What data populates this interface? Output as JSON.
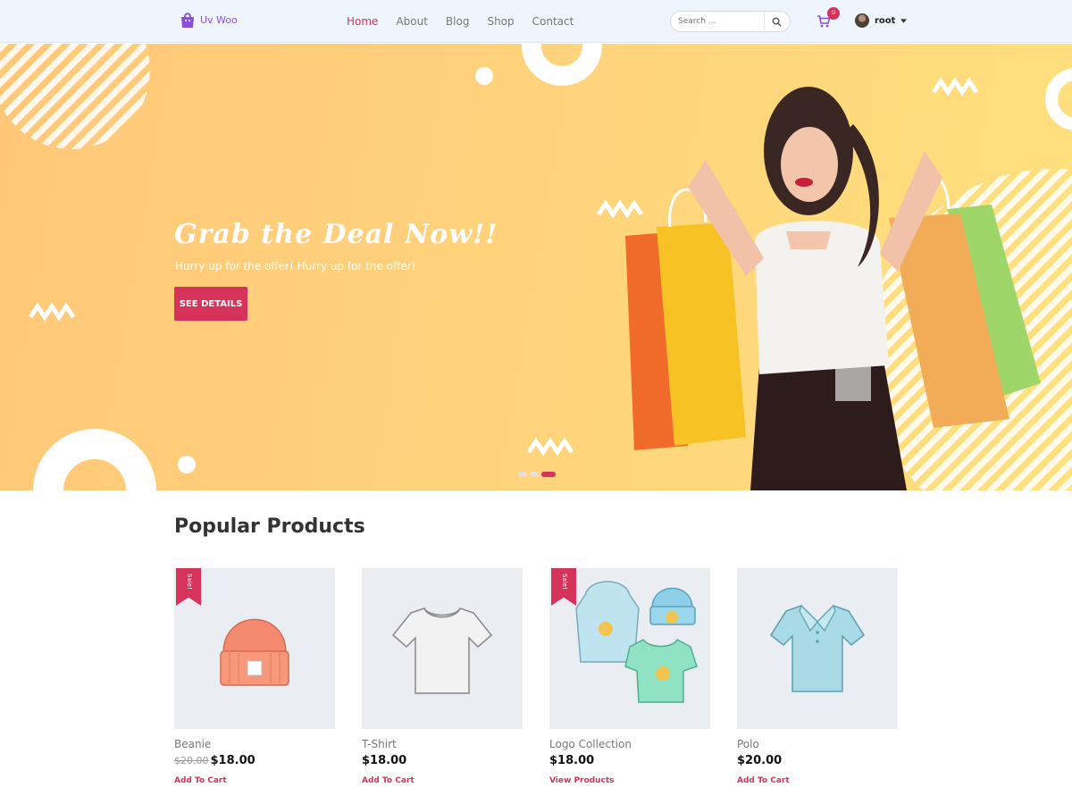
{
  "header": {
    "logo_text": "Uv Woo",
    "nav": [
      {
        "label": "Home",
        "active": true
      },
      {
        "label": "About",
        "active": false
      },
      {
        "label": "Blog",
        "active": false
      },
      {
        "label": "Shop",
        "active": false
      },
      {
        "label": "Contact",
        "active": false
      }
    ],
    "search_placeholder": "Search ...",
    "cart_count": "0",
    "user_name": "root"
  },
  "hero": {
    "title": "Grab the Deal Now!!",
    "subtitle": "Hurry up for the offer! Hurry up for the offer!",
    "button_label": "SEE DETAILS",
    "active_slide": 3,
    "slide_count": 3
  },
  "products_section": {
    "title": "Popular Products",
    "items": [
      {
        "name": "Beanie",
        "sale": true,
        "sale_label": "Sale!",
        "old_price": "$20.00",
        "price": "$18.00",
        "action": "Add To Cart"
      },
      {
        "name": "T-Shirt",
        "sale": false,
        "sale_label": "",
        "old_price": "",
        "price": "$18.00",
        "action": "Add To Cart"
      },
      {
        "name": "Logo Collection",
        "sale": true,
        "sale_label": "Sale!",
        "old_price": "",
        "price": "$18.00",
        "action": "View Products"
      },
      {
        "name": "Polo",
        "sale": false,
        "sale_label": "",
        "old_price": "",
        "price": "$20.00",
        "action": "Add To Cart"
      }
    ]
  },
  "colors": {
    "accent": "#d6335a",
    "logo": "#8a4fd8",
    "header_bg": "#eef5fd",
    "hero_bg": "#ffd27c"
  },
  "icons": {
    "logo": "shopping-bag-icon",
    "search": "search-icon",
    "cart": "cart-icon",
    "user_menu": "chevron-down-icon"
  }
}
